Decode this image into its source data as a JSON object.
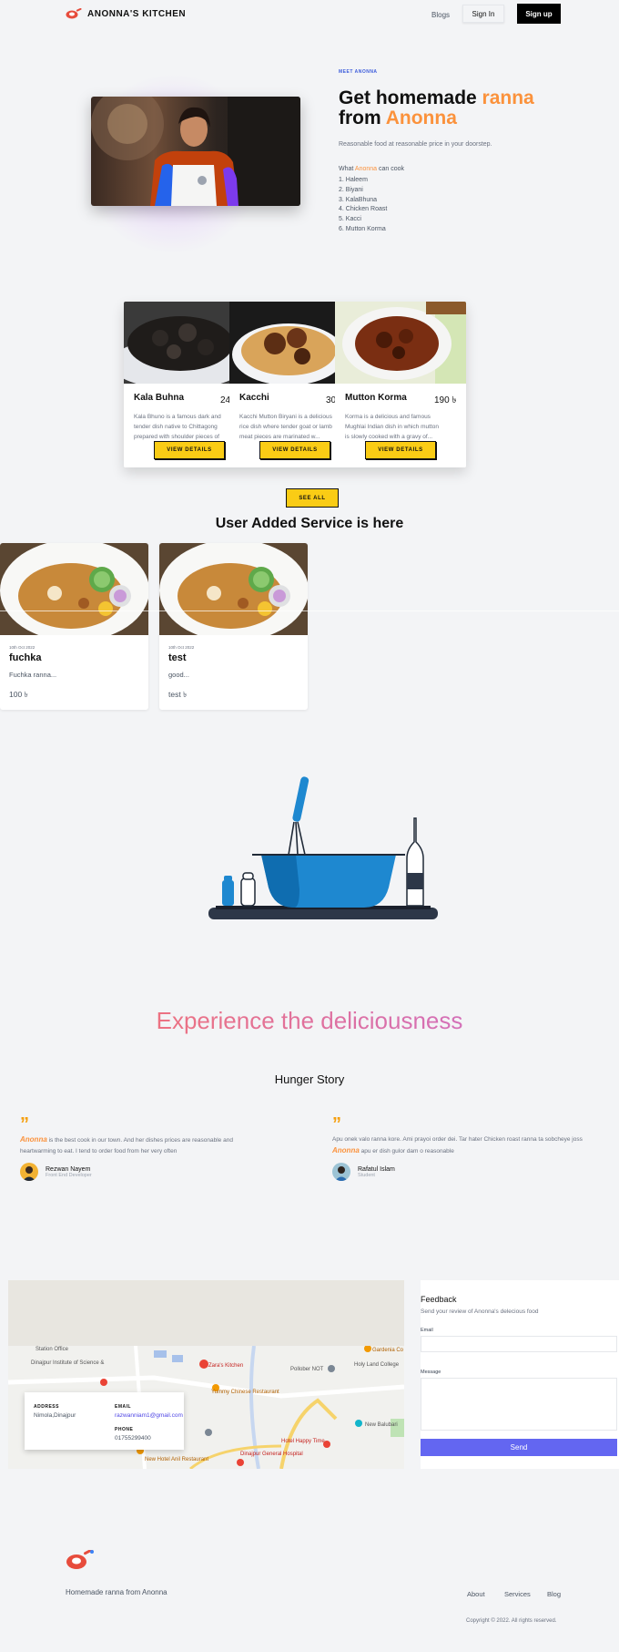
{
  "nav": {
    "brand": "ANONNA'S KITCHEN",
    "links": {
      "blogs": "Blogs",
      "signin": "Sign In",
      "signup": "Sign up"
    }
  },
  "hero": {
    "kicker": "MEET ANONNA",
    "title_part1": "Get homemade ",
    "title_accent1": "ranna",
    "title_part2": "from ",
    "title_accent2": "Anonna",
    "subtitle": "Reasonable food at reasonable price in your doorstep.",
    "what_prefix": "What ",
    "what_name": "Anonna",
    "what_suffix": " can cook",
    "dishes": [
      "1. Haleem",
      "2. Biyani",
      "3. KalaBhuna",
      "4. Chicken Roast",
      "5. Kacci",
      "6. Mutton Korma"
    ]
  },
  "services": [
    {
      "title": "Kala Buhna",
      "price": "240 ৳",
      "desc": "Kala Bhuno is a famous dark and tender dish native to Chittagong prepared with shoulder pieces of beef...",
      "button": "VIEW DETAILS"
    },
    {
      "title": "Kacchi",
      "price": "300 ৳",
      "desc": "Kacchi Mutton Biryani is a delicious rice dish where tender goat or lamb meat pieces are marinated w...",
      "button": "VIEW DETAILS"
    },
    {
      "title": "Mutton Korma",
      "price": "190 ৳",
      "desc": "Korma is a delicious and famous Mughlai Indian dish in which mutton is slowly cooked with a gravy of...",
      "button": "VIEW DETAILS"
    }
  ],
  "see_all": "SEE ALL",
  "user_heading": "User Added Service is here",
  "user_services": [
    {
      "date": "10th Oct 2022",
      "title": "fuchka",
      "desc": "Fuchka ranna...",
      "price": "100 ৳"
    },
    {
      "date": "10th Oct 2022",
      "title": "test",
      "desc": "good...",
      "price": "test ৳"
    }
  ],
  "experience_title": "Experience the deliciousness",
  "story_title": "Hunger Story",
  "testimonials": [
    {
      "accent": "Anonna",
      "text_before": "",
      "text_after": " is the best cook in our town. And her dishes prices are reasonable and heartwarming to eat. I tend to order food from her very often",
      "name": "Rezwan Nayem",
      "role": "Front End Developer"
    },
    {
      "accent": "Anonna",
      "text_before": "Apu onek valo ranna kore. Ami prayoi order dei. Tar hater Chicken roast ranna ta sobcheye joss ",
      "text_after": " apu er dish gulor dam o reasonable",
      "name": "Rafatul Islam",
      "role": "Student"
    }
  ],
  "map_card": {
    "address_label": "ADDRESS",
    "address": "Nimola,Dinajpur",
    "email_label": "EMAIL",
    "email": "razwanniam1@gmail.com",
    "phone_label": "PHONE",
    "phone": "01755299400"
  },
  "map_labels": [
    "Gardenia Co",
    "Zara's Kitchen",
    "Pollober NOT",
    "Holy Land College",
    "Yummy Chinese Restaurant",
    "New Balubari",
    "Hotel Happy Time",
    "Dinajpur General Hospital",
    "New Hotel Anil Restaurant",
    "Dinajpur Institute of Science &",
    "Station Office"
  ],
  "feedback": {
    "title": "Feedback",
    "subtitle": "Send your review of Anonna's delecious food",
    "email_label": "Email",
    "message_label": "Message",
    "send": "Send"
  },
  "footer": {
    "tagline": "Homemade ranna from Anonna",
    "links": {
      "about": "About",
      "services": "Services",
      "blog": "Blog"
    },
    "copyright": "Copyright © 2022. All rights reserved."
  },
  "colors": {
    "accent": "#fb923c",
    "button": "#facc15",
    "send": "#6366f1"
  }
}
